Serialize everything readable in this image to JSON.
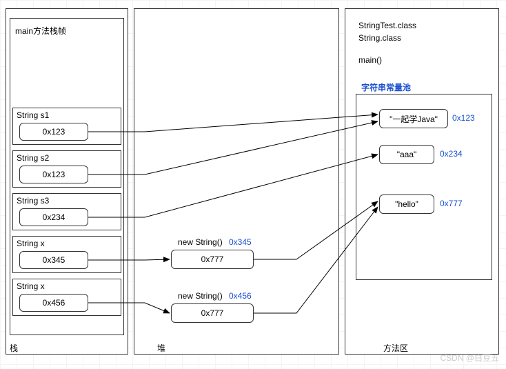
{
  "stack": {
    "area_label": "栈",
    "frame_title": "main方法栈帧",
    "vars": [
      {
        "name": "String s1",
        "value": "0x123"
      },
      {
        "name": "String s2",
        "value": "0x123"
      },
      {
        "name": "String s3",
        "value": "0x234"
      },
      {
        "name": "String x",
        "value": "0x345"
      },
      {
        "name": "String x",
        "value": "0x456"
      }
    ]
  },
  "heap": {
    "area_label": "堆",
    "objects": [
      {
        "header": "new String()",
        "addr": "0x345",
        "value": "0x777"
      },
      {
        "header": "new String()",
        "addr": "0x456",
        "value": "0x777"
      }
    ]
  },
  "method_area": {
    "area_label": "方法区",
    "classes": [
      "StringTest.class",
      "String.class"
    ],
    "methods": [
      "main()"
    ],
    "pool_title": "字符串常量池",
    "pool": [
      {
        "literal": "\"一起学Java\"",
        "addr": "0x123"
      },
      {
        "literal": "\"aaa\"",
        "addr": "0x234"
      },
      {
        "literal": "\"hello\"",
        "addr": "0x777"
      }
    ]
  },
  "watermark": "CSDN @白豆五"
}
